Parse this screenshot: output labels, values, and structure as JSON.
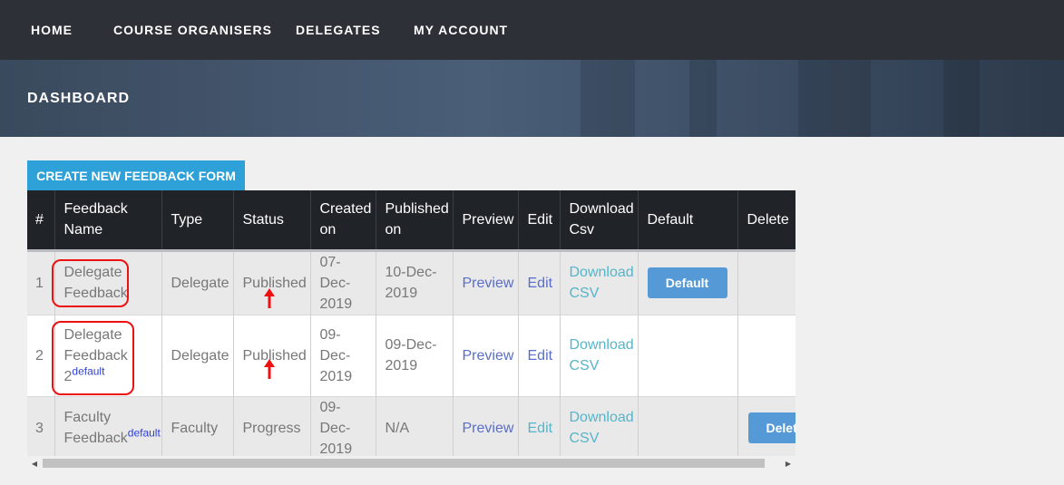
{
  "nav": {
    "items": [
      {
        "label": "HOME"
      },
      {
        "label": "COURSE ORGANISERS"
      },
      {
        "label": "DELEGATES"
      },
      {
        "label": "MY ACCOUNT"
      }
    ]
  },
  "banner": {
    "title": "DASHBOARD"
  },
  "toolbar": {
    "create_label": "CREATE NEW FEEDBACK FORM"
  },
  "table": {
    "headers": {
      "num": "#",
      "name_line1": "Feedback",
      "name_line2": "Name",
      "type": "Type",
      "status": "Status",
      "created_line1": "Created",
      "created_line2": "on",
      "published_line1": "Published",
      "published_line2": "on",
      "preview": "Preview",
      "edit": "Edit",
      "download_line1": "Download",
      "download_line2": "Csv",
      "default": "Default",
      "delete": "Delete"
    },
    "rows": [
      {
        "num": "1",
        "name_line1": "Delegate",
        "name_line2": "Feedback",
        "type": "Delegate",
        "status": "Published",
        "created_line1": "07-Dec-",
        "created_line2": "2019",
        "published_line1": "10-Dec-",
        "published_line2": "2019",
        "preview": "Preview",
        "edit": "Edit",
        "download_line1": "Download",
        "download_line2": "CSV",
        "default_button": "Default"
      },
      {
        "num": "2",
        "name_line1": "Delegate",
        "name_line2": "Feedback",
        "name_line3": "2",
        "tag": "default",
        "type": "Delegate",
        "status": "Published",
        "created_line1": "09-Dec-",
        "created_line2": "2019",
        "published_line1": "09-Dec-",
        "published_line2": "2019",
        "preview": "Preview",
        "edit": "Edit",
        "download_line1": "Download",
        "download_line2": "CSV"
      },
      {
        "num": "3",
        "name_line1": "Faculty",
        "name_line2": "Feedback",
        "tag": "default",
        "type": "Faculty",
        "status": "Progress",
        "created_line1": "09-Dec-",
        "created_line2": "2019",
        "published": "N/A",
        "preview": "Preview",
        "edit": "Edit",
        "download_line1": "Download",
        "download_line2": "CSV",
        "delete_button": "Delete"
      }
    ]
  },
  "colors": {
    "nav_bg": "#2d3036",
    "accent": "#2da1d8",
    "button": "#559ad6",
    "annotation": "#ee1111",
    "link": "#5a6ec9",
    "link_alt": "#56b5ca"
  },
  "icons": {
    "annotation_arrow": "red-up-arrow-icon",
    "scroll_left": "scroll-left-arrow-icon",
    "scroll_right": "scroll-right-arrow-icon"
  }
}
